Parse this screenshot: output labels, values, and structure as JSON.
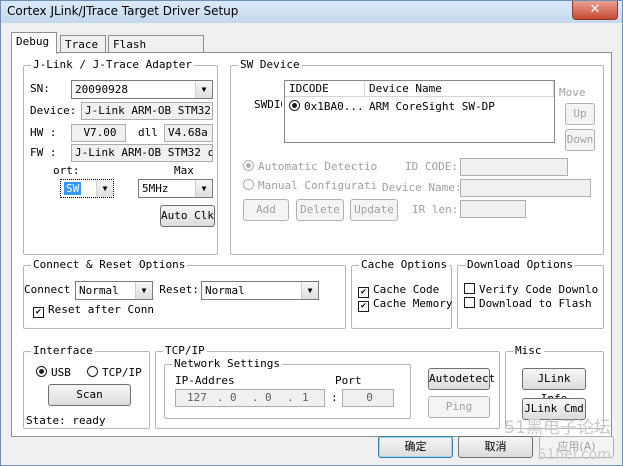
{
  "window": {
    "title": "Cortex JLink/JTrace Target Driver Setup",
    "close_glyph": "✕"
  },
  "tabs": [
    {
      "label": "Debug"
    },
    {
      "label": "Trace"
    },
    {
      "label": "Flash Download"
    }
  ],
  "adapter": {
    "title": "J-Link / J-Trace Adapter",
    "sn_label": "SN:",
    "sn_value": "20090928",
    "device_label": "Device:",
    "device_value": "J-Link ARM-OB STM32",
    "hw_label": "HW :",
    "hw_value": "V7.00",
    "dll_label": "dll",
    "dll_value": "V4.68a",
    "fw_label": "FW :",
    "fw_value": "J-Link ARM-OB STM32 comp",
    "port_label": "ort:",
    "port_value": "SW",
    "max_label": "Max",
    "max_value": "5MHz",
    "auto_clk": "Auto Clk"
  },
  "sw_device": {
    "title": "SW Device",
    "swdio_label": "SWDIO",
    "columns": [
      "IDCODE",
      "Device Name"
    ],
    "rows": [
      {
        "idcode": "0x1BA0...",
        "name": "ARM CoreSight SW-DP"
      }
    ],
    "move_label": "Move",
    "up": "Up",
    "down": "Down",
    "automatic": "Automatic Detectio",
    "manual": "Manual Configurati",
    "id_code_label": "ID CODE:",
    "device_name_label": "Device Name:",
    "ir_len_label": "IR len:",
    "add": "Add",
    "delete": "Delete",
    "update": "Update"
  },
  "connect": {
    "title": "Connect & Reset Options",
    "connect_label": "Connect:",
    "connect_value": "Normal",
    "reset_label": "Reset:",
    "reset_value": "Normal",
    "reset_after": "Reset after Conn",
    "reset_after_checked": true
  },
  "cache": {
    "title": "Cache Options",
    "code": "Cache Code",
    "code_checked": true,
    "memory": "Cache Memory",
    "memory_checked": true
  },
  "download": {
    "title": "Download Options",
    "verify": "Verify Code Downlo",
    "verify_checked": false,
    "to_flash": "Download to Flash",
    "to_flash_checked": false
  },
  "interface": {
    "title": "Interface",
    "usb": "USB",
    "usb_selected": true,
    "tcpip": "TCP/IP",
    "scan": "Scan",
    "state": "State: ready"
  },
  "tcpip": {
    "title": "TCP/IP",
    "network_title": "Network Settings",
    "ip_label": "IP-Addres",
    "ip": [
      "127",
      "0",
      "0",
      "1"
    ],
    "port_label": "Port",
    "port_value": "0",
    "autodetect": "Autodetect",
    "ping": "Ping"
  },
  "misc": {
    "title": "Misc",
    "jlink_info": "JLink Info",
    "jlink_cmd": "JLink Cmd"
  },
  "footer": {
    "ok": "确定",
    "cancel": "取消",
    "apply": "应用(A)"
  },
  "watermark": {
    "line1": "51黑电子论坛",
    "line2": "51hei.com"
  }
}
